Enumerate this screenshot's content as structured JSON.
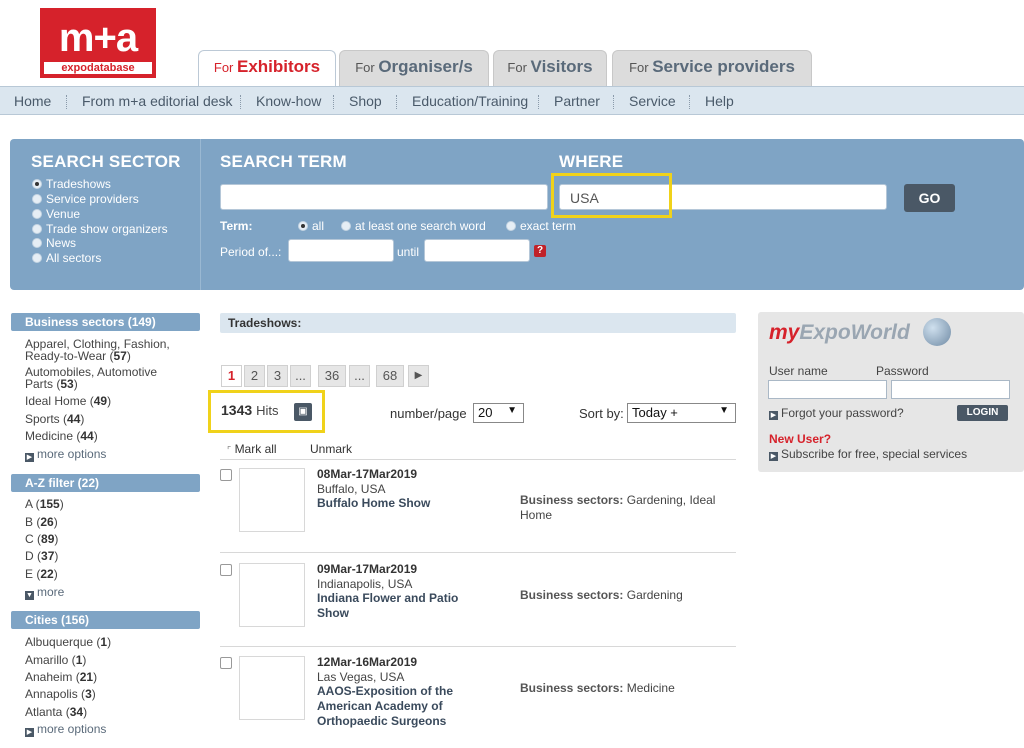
{
  "logo": {
    "top": "m+a",
    "bottom": "expodatabase"
  },
  "tabs": [
    {
      "prefix": "For",
      "label": "Exhibitors"
    },
    {
      "prefix": "For",
      "label": "Organiser/s"
    },
    {
      "prefix": "For",
      "label": "Visitors"
    },
    {
      "prefix": "For",
      "label": "Service providers"
    }
  ],
  "nav": [
    "Home",
    "From m+a editorial desk",
    "Know-how",
    "Shop",
    "Education/Training",
    "Partner",
    "Service",
    "Help"
  ],
  "search": {
    "sector_title": "SEARCH SECTOR",
    "term_title": "SEARCH TERM",
    "where_title": "WHERE",
    "sectors": [
      "Tradeshows",
      "Service providers",
      "Venue",
      "Trade show organizers",
      "News",
      "All sectors"
    ],
    "where_value": "USA",
    "go_label": "GO",
    "term_label": "Term:",
    "term_opts": [
      "all",
      "at least one search word",
      "exact term"
    ],
    "period_label": "Period of...:",
    "until_label": "until",
    "help": "?"
  },
  "sidebar": {
    "business_head": "Business sectors (149)",
    "business": [
      {
        "name": "Apparel, Clothing, Fashion, Ready-to-Wear",
        "count": "57"
      },
      {
        "name": "Automobiles, Automotive Parts",
        "count": "53"
      },
      {
        "name": "Ideal Home",
        "count": "49"
      },
      {
        "name": "Sports",
        "count": "44"
      },
      {
        "name": "Medicine",
        "count": "44"
      }
    ],
    "business_more": "more options",
    "az_head": "A-Z filter (22)",
    "az": [
      {
        "name": "A",
        "count": "155"
      },
      {
        "name": "B",
        "count": "26"
      },
      {
        "name": "C",
        "count": "89"
      },
      {
        "name": "D",
        "count": "37"
      },
      {
        "name": "E",
        "count": "22"
      }
    ],
    "az_more": "more",
    "cities_head": "Cities (156)",
    "cities": [
      {
        "name": "Albuquerque",
        "count": "1"
      },
      {
        "name": "Amarillo",
        "count": "1"
      },
      {
        "name": "Anaheim",
        "count": "21"
      },
      {
        "name": "Annapolis",
        "count": "3"
      },
      {
        "name": "Atlanta",
        "count": "34"
      }
    ],
    "cities_more": "more options"
  },
  "main": {
    "heading": "Tradeshows:",
    "pages": [
      "1",
      "2",
      "3",
      "...",
      "36",
      "...",
      "68",
      "▶"
    ],
    "hits_count": "1343",
    "hits_label": "Hits",
    "per_page_label": "number/page",
    "per_page_value": "20",
    "sort_label": "Sort by:",
    "sort_value": "Today +",
    "mark_all": "Mark all",
    "unmark": "Unmark",
    "sectors_label": "Business sectors:",
    "events": [
      {
        "date": "08Mar-17Mar2019",
        "city": "Buffalo, USA",
        "name": "Buffalo Home Show",
        "sectors": "Gardening, Ideal Home"
      },
      {
        "date": "09Mar-17Mar2019",
        "city": "Indianapolis, USA",
        "name": "Indiana Flower and Patio Show",
        "sectors": "Gardening"
      },
      {
        "date": "12Mar-16Mar2019",
        "city": "Las Vegas, USA",
        "name": "AAOS-Exposition of the American Academy of Orthopaedic Surgeons",
        "sectors": "Medicine"
      }
    ]
  },
  "login": {
    "brand_my": "my",
    "brand_rest": "ExpoWorld",
    "user_label": "User name",
    "pass_label": "Password",
    "forgot": "Forgot your password?",
    "login_btn": "LOGIN",
    "new_user": "New User?",
    "subscribe": "Subscribe for free, special services"
  }
}
